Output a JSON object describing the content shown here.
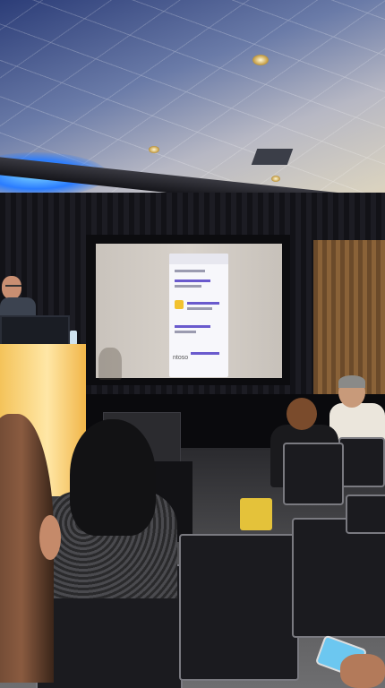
{
  "scene": {
    "screen": {
      "phone_logo": "ntoso"
    },
    "colors": {
      "ceiling_blue": "#2c3d78",
      "podium_yellow": "#f4c35a",
      "screen_accent": "#6a5acd"
    }
  }
}
